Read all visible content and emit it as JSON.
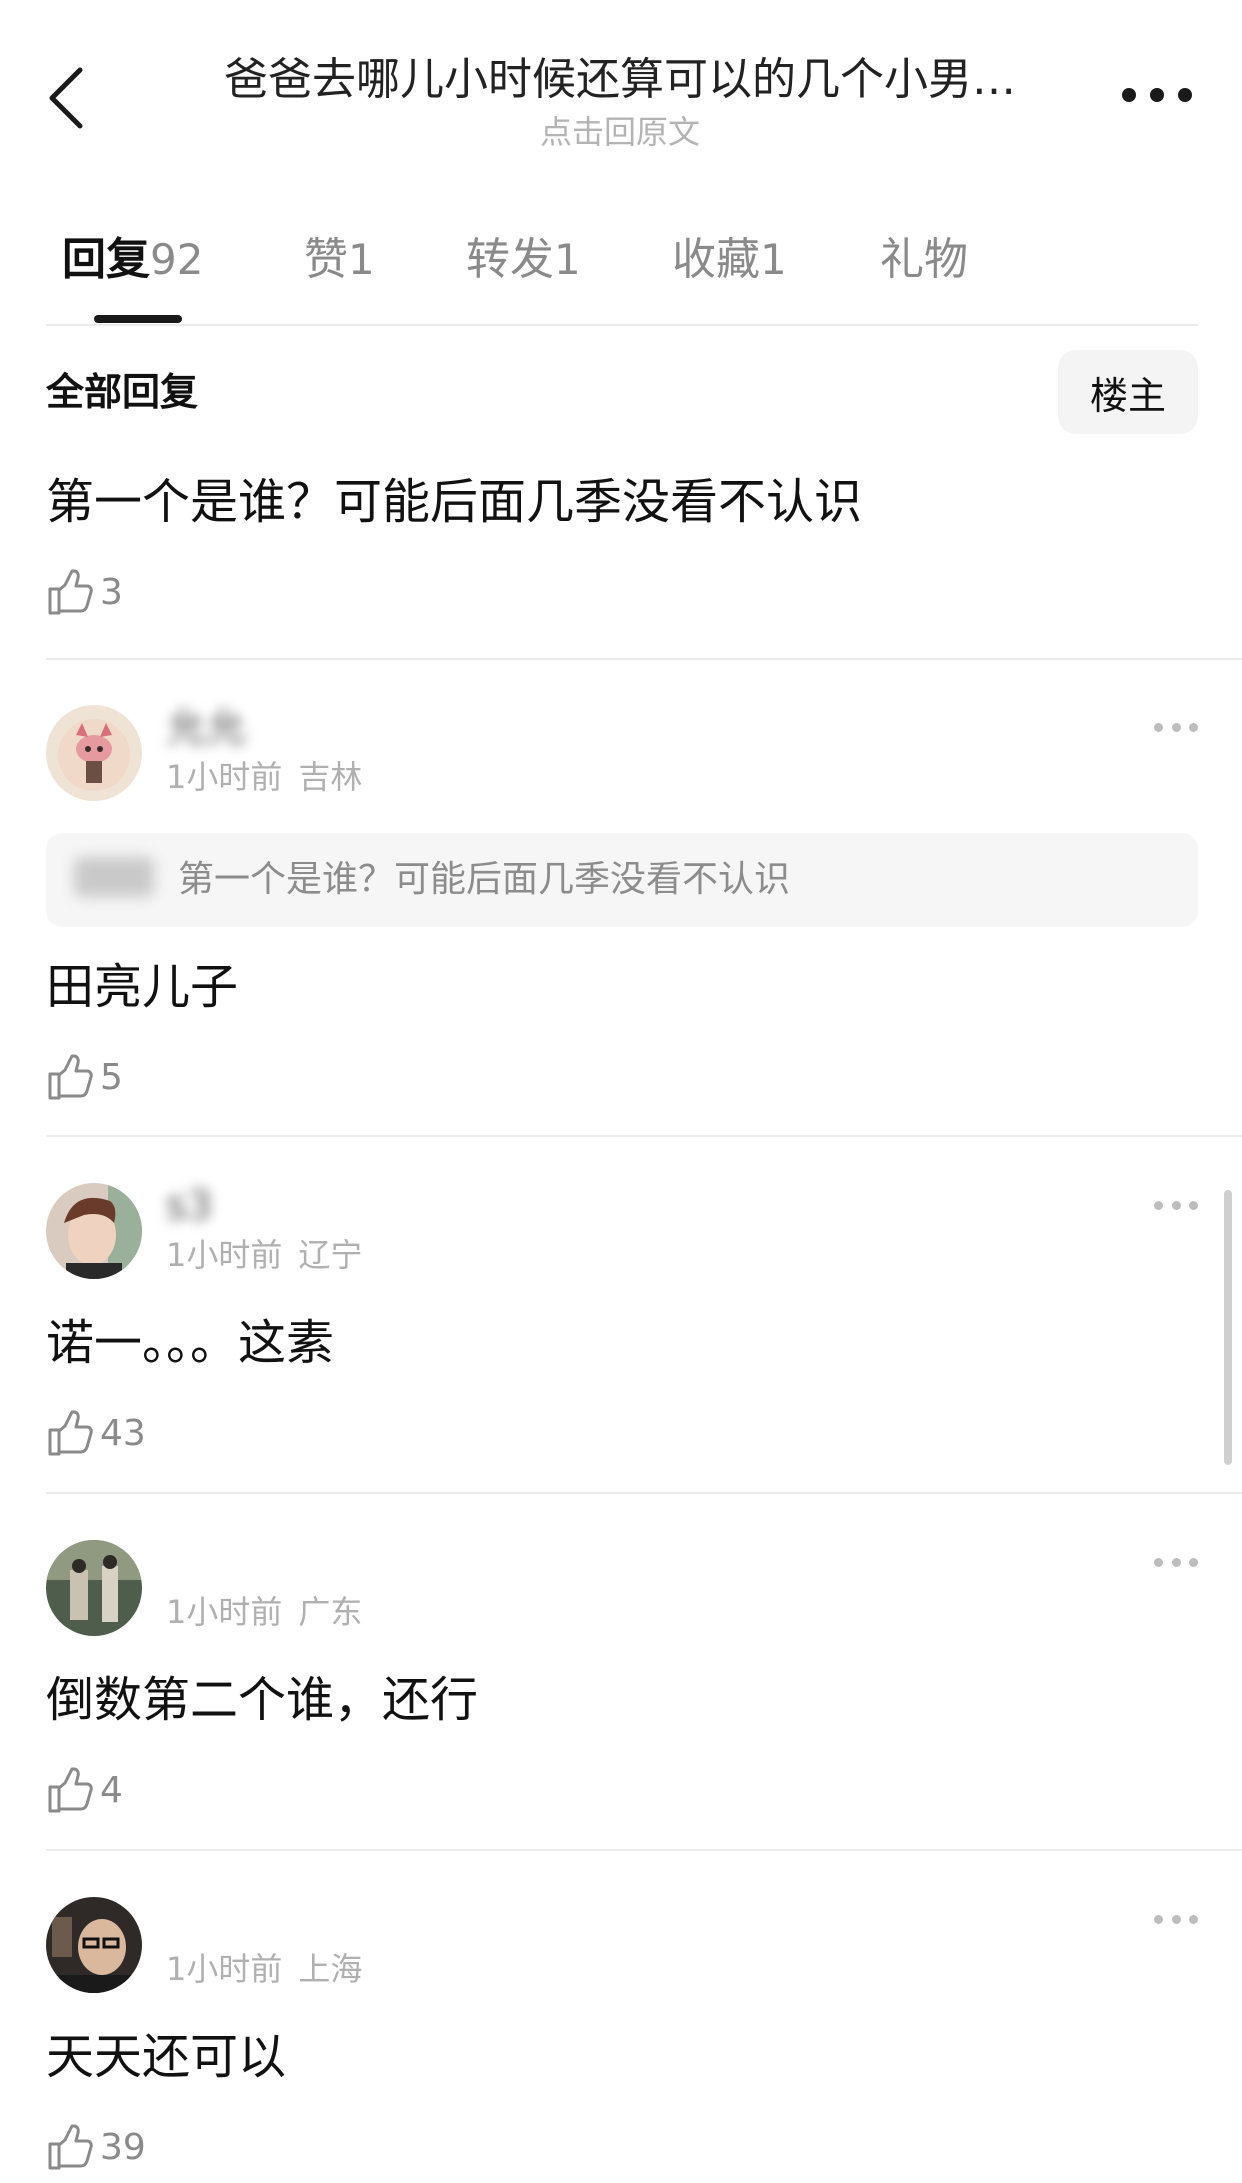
{
  "header": {
    "title": "爸爸去哪儿小时候还算可以的几个小男…",
    "subtitle": "点击回原文",
    "back_icon": "chevron-left-icon",
    "more_icon": "more-horizontal-icon"
  },
  "tabs": [
    {
      "label": "回复",
      "count": "92",
      "active": true
    },
    {
      "label": "赞",
      "count": "1",
      "active": false
    },
    {
      "label": "转发",
      "count": "1",
      "active": false
    },
    {
      "label": "收藏",
      "count": "1",
      "active": false
    },
    {
      "label": "礼物",
      "count": "",
      "active": false
    }
  ],
  "section": {
    "title": "全部回复",
    "op_button": "楼主"
  },
  "main_comment": {
    "text": "第一个是谁？可能后面几季没看不认识",
    "likes": "3"
  },
  "replies": [
    {
      "username": "允允",
      "time": "1小时前",
      "location": "吉林",
      "quote": "第一个是谁？可能后面几季没看不认识",
      "text": "田亮儿子",
      "likes": "5",
      "avatar_color": "#e8c9b8"
    },
    {
      "username": "s3",
      "time": "1小时前",
      "location": "辽宁",
      "text": "诺一。。。这素",
      "likes": "43",
      "avatar_color": "#7a5a48"
    },
    {
      "username": "",
      "time": "1小时前",
      "location": "广东",
      "text": "倒数第二个谁，还行",
      "likes": "4",
      "avatar_color": "#5b6b58"
    },
    {
      "username": "",
      "time": "1小时前",
      "location": "上海",
      "text": "天天还可以",
      "likes": "39",
      "avatar_color": "#3a3430"
    }
  ]
}
